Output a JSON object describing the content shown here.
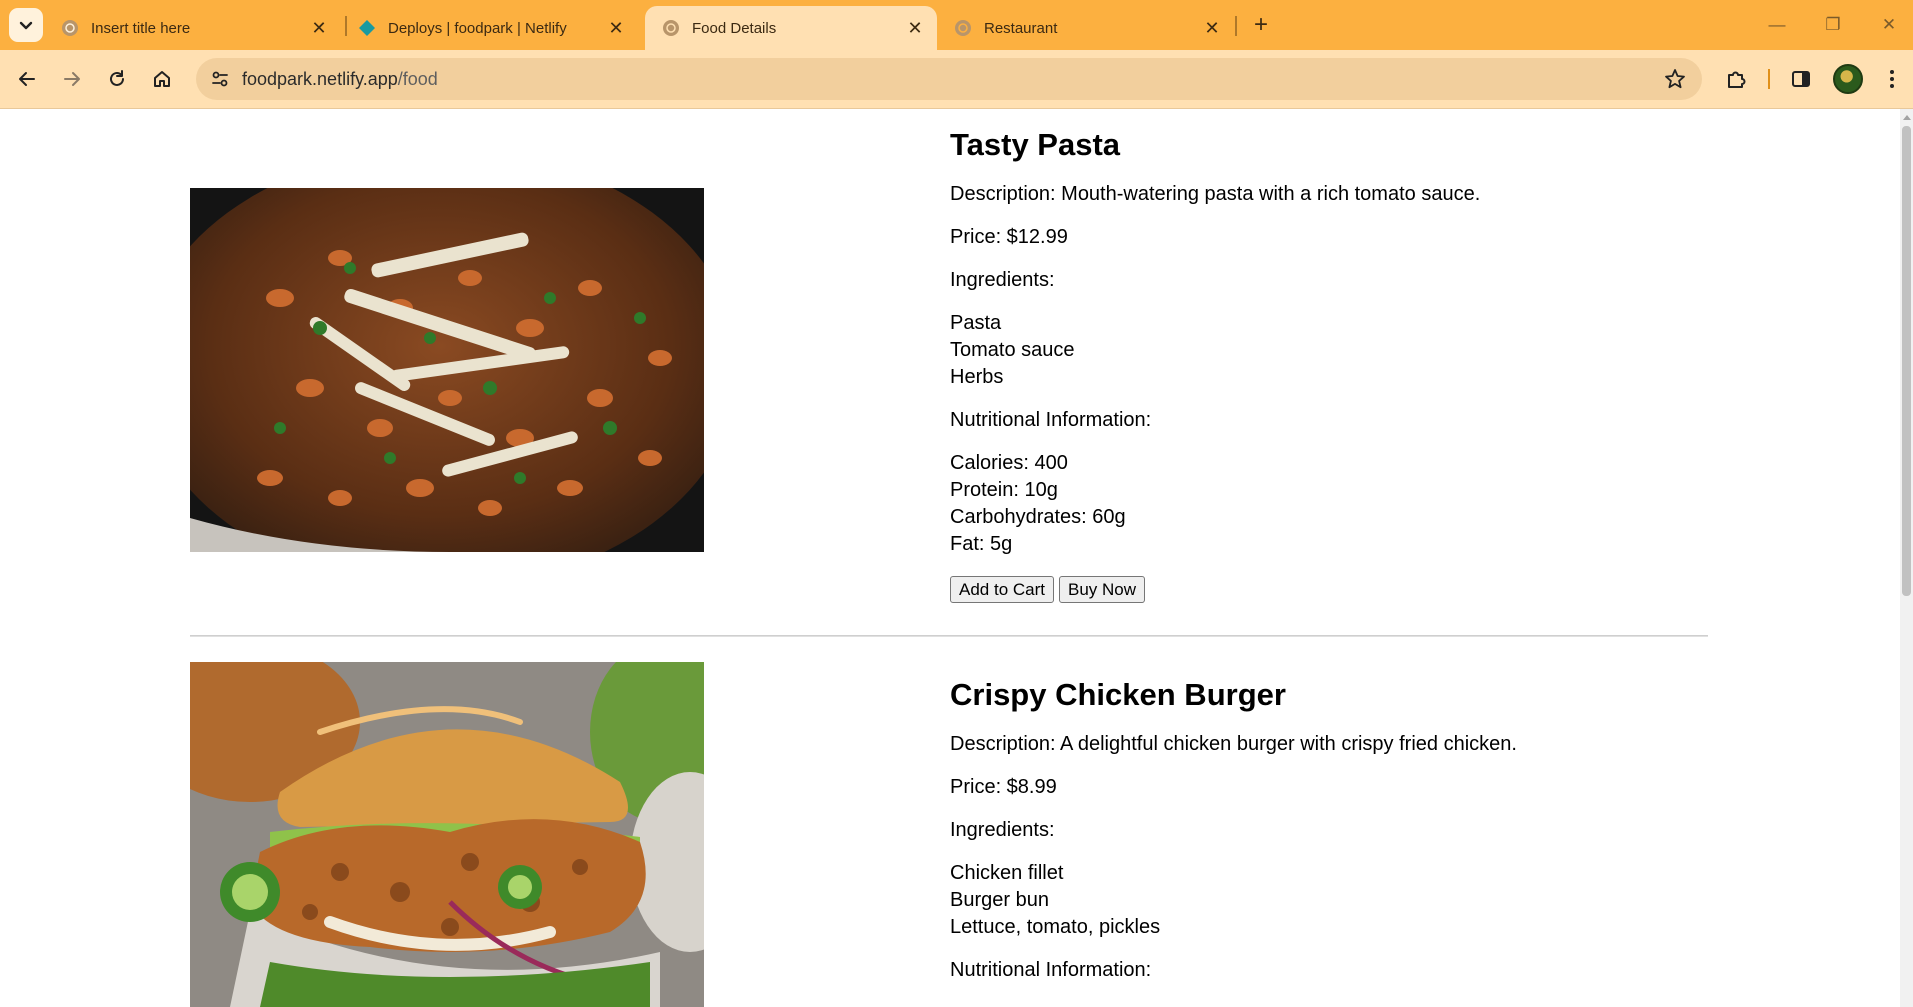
{
  "browser": {
    "tabs": [
      {
        "title": "Insert title here",
        "active": false
      },
      {
        "title": "Deploys | foodpark | Netlify",
        "active": false
      },
      {
        "title": "Food Details",
        "active": true
      },
      {
        "title": "Restaurant",
        "active": false
      }
    ],
    "url_host": "foodpark.netlify.app",
    "url_path": "/food"
  },
  "foods": [
    {
      "name": "Tasty Pasta",
      "description": "Description: Mouth-watering pasta with a rich tomato sauce.",
      "price": "Price: $12.99",
      "ingredients_label": "Ingredients:",
      "ingredients": [
        "Pasta",
        "Tomato sauce",
        "Herbs"
      ],
      "nutrition_label": "Nutritional Information:",
      "nutrition": [
        "Calories: 400",
        "Protein: 10g",
        "Carbohydrates: 60g",
        "Fat: 5g"
      ],
      "add_to_cart": "Add to Cart",
      "buy_now": "Buy Now"
    },
    {
      "name": "Crispy Chicken Burger",
      "description": "Description: A delightful chicken burger with crispy fried chicken.",
      "price": "Price: $8.99",
      "ingredients_label": "Ingredients:",
      "ingredients": [
        "Chicken fillet",
        "Burger bun",
        "Lettuce, tomato, pickles"
      ],
      "nutrition_label": "Nutritional Information:"
    }
  ]
}
